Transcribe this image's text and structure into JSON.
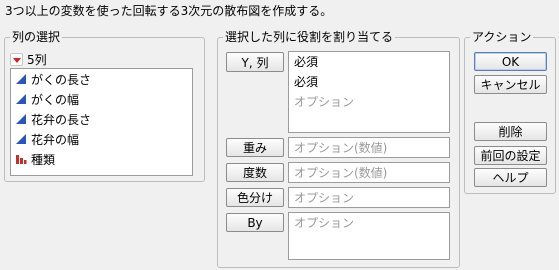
{
  "header": {
    "instruction": "3つ以上の変数を使った回転する3次元の散布図を作成する。"
  },
  "columns_panel": {
    "title": "列の選択",
    "count_label": "5列",
    "items": [
      {
        "label": "がくの長さ",
        "icon": "continuous-icon"
      },
      {
        "label": "がくの幅",
        "icon": "continuous-icon"
      },
      {
        "label": "花弁の長さ",
        "icon": "continuous-icon"
      },
      {
        "label": "花弁の幅",
        "icon": "continuous-icon"
      },
      {
        "label": "種類",
        "icon": "nominal-icon"
      }
    ]
  },
  "roles_panel": {
    "title": "選択した列に役割を割り当てる",
    "yx": {
      "button": "Y, 列",
      "lines": [
        "必須",
        "必須",
        "オプション"
      ]
    },
    "weight": {
      "button": "重み",
      "placeholder": "オプション(数値)"
    },
    "freq": {
      "button": "度数",
      "placeholder": "オプション(数値)"
    },
    "color": {
      "button": "色分け",
      "placeholder": "オプション"
    },
    "by": {
      "button": "By",
      "placeholder": "オプション"
    }
  },
  "actions_panel": {
    "title": "アクション",
    "ok": "OK",
    "cancel": "キャンセル",
    "remove": "削除",
    "recall": "前回の設定",
    "help": "ヘルプ"
  },
  "colors": {
    "continuous": "#2a56b8",
    "nominal": "#c2302a"
  }
}
